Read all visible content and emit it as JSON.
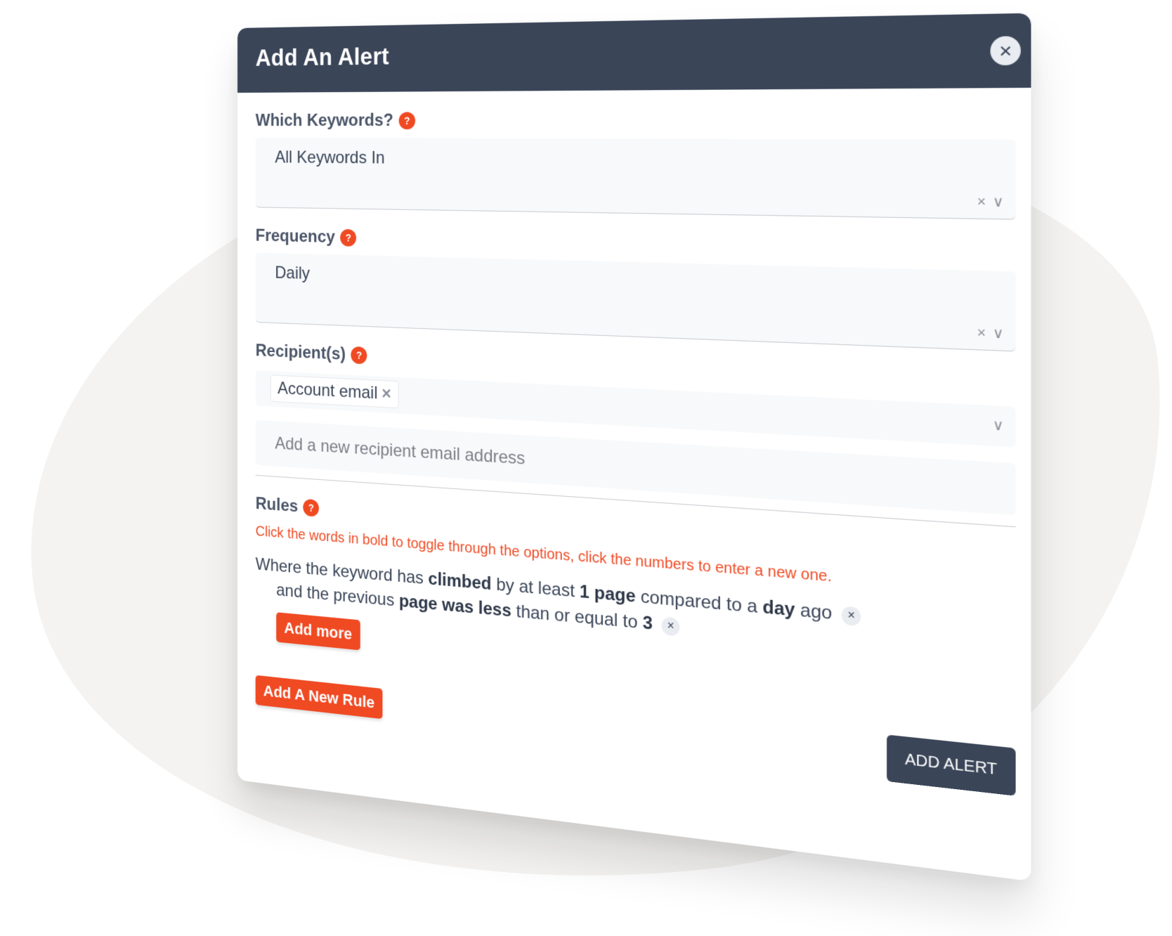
{
  "modal": {
    "title": "Add An Alert",
    "close_icon": "close-icon"
  },
  "keywords": {
    "label": "Which Keywords?",
    "help": "?",
    "value": "All Keywords In",
    "clear": "×",
    "chevron": "⌄"
  },
  "frequency": {
    "label": "Frequency",
    "help": "?",
    "value": "Daily",
    "clear": "×",
    "chevron": "⌄"
  },
  "recipients": {
    "label": "Recipient(s)",
    "help": "?",
    "chips": [
      {
        "label": "Account email",
        "remove": "×"
      }
    ],
    "chevron": "⌄",
    "new_email_placeholder": "Add a new recipient email address"
  },
  "rules": {
    "label": "Rules",
    "help": "?",
    "hint": "Click the words in bold to toggle through the options, click the numbers to enter a new one.",
    "line1": {
      "t1": "Where the keyword has ",
      "b1": "climbed",
      "t2": " by at least ",
      "b2": "1",
      "t3": " ",
      "b3": "page",
      "t4": " compared to a ",
      "b4": "day",
      "t5": " ago",
      "remove": "×"
    },
    "line2": {
      "t1": "and the previous ",
      "b1": "page",
      "t2": " ",
      "b2": "was less",
      "t3": " than or equal to ",
      "b3": "3",
      "remove": "×"
    },
    "add_more": "Add more"
  },
  "footer": {
    "add_rule": "Add A New Rule",
    "add_alert": "ADD ALERT"
  },
  "colors": {
    "header": "#3a4558",
    "accent": "#f04a23"
  }
}
